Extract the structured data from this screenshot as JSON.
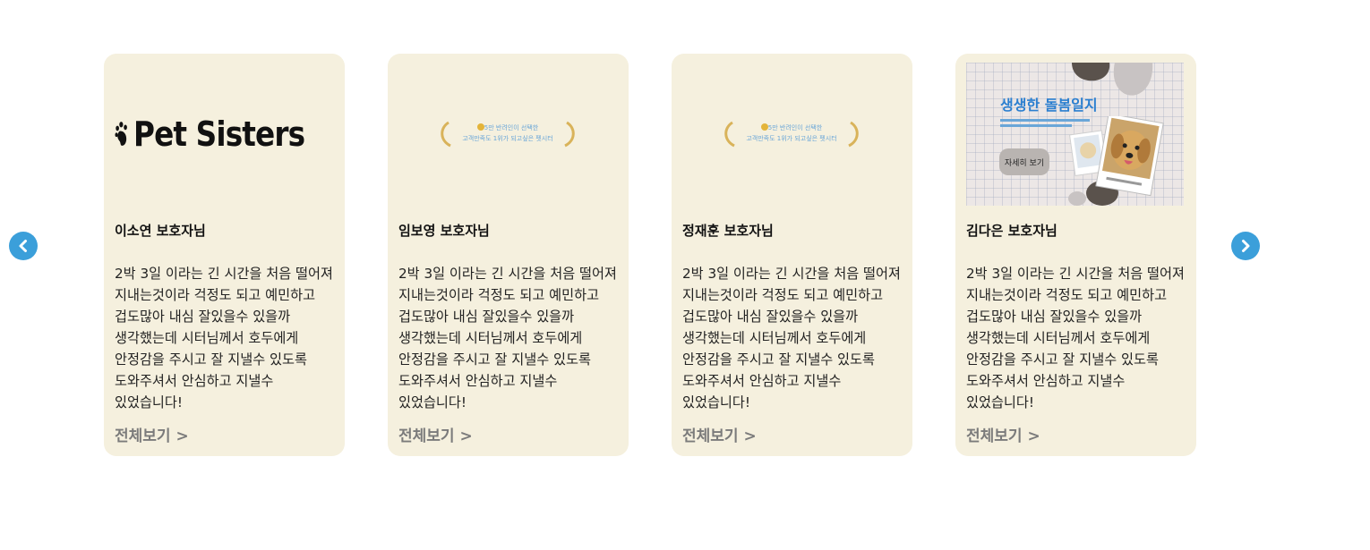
{
  "colors": {
    "card_bg": "#f5f0de",
    "nav_button": "#3b9fda",
    "more_link": "#7b7b7b",
    "banner_title": "#2b7fd0"
  },
  "carousel": {
    "prev_icon": "chevron-left-icon",
    "next_icon": "chevron-right-icon",
    "cards": [
      {
        "name": "이소연 보호자님",
        "image": "paw-logo",
        "logo_text": "Pet Sisters",
        "review": "2박 3일 이라는 긴 시간을 처음 떨어져 지내는것이라 걱정도 되고 예민하고 겁도많아 내심 잘있을수 있을까 생각했는데 시터님께서 호두에게 안정감을 주시고 잘 지낼수 있도록 도와주셔서 안심하고 지낼수 있었습니다!",
        "more": "전체보기 >"
      },
      {
        "name": "임보영 보호자님",
        "image": "laurel-badge",
        "badge_line1": "5만 반려인이 선택한",
        "badge_line2": "고객만족도 1위가 되고싶은 펫시터",
        "review": "2박 3일 이라는 긴 시간을 처음 떨어져 지내는것이라 걱정도 되고 예민하고 겁도많아 내심 잘있을수 있을까 생각했는데 시터님께서 호두에게 안정감을 주시고 잘 지낼수 있도록 도와주셔서 안심하고 지낼수 있었습니다!",
        "more": "전체보기 >"
      },
      {
        "name": "정재훈 보호자님",
        "image": "laurel-badge",
        "badge_line1": "5만 반려인이 선택한",
        "badge_line2": "고객만족도 1위가 되고싶은 펫시터",
        "review": "2박 3일 이라는 긴 시간을 처음 떨어져 지내는것이라 걱정도 되고 예민하고 겁도많아 내심 잘있을수 있을까 생각했는데 시터님께서 호두에게 안정감을 주시고 잘 지낼수 있도록 도와주셔서 안심하고 지낼수 있었습니다!",
        "more": "전체보기 >"
      },
      {
        "name": "김다은 보호자님",
        "image": "care-diary-banner",
        "banner_title": "생생한 돌봄일지",
        "banner_button": "자세히 보기",
        "review": "2박 3일 이라는 긴 시간을 처음 떨어져 지내는것이라 걱정도 되고 예민하고 겁도많아 내심 잘있을수 있을까 생각했는데 시터님께서 호두에게 안정감을 주시고 잘 지낼수 있도록 도와주셔서 안심하고 지낼수 있었습니다!",
        "more": "전체보기 >"
      }
    ]
  }
}
